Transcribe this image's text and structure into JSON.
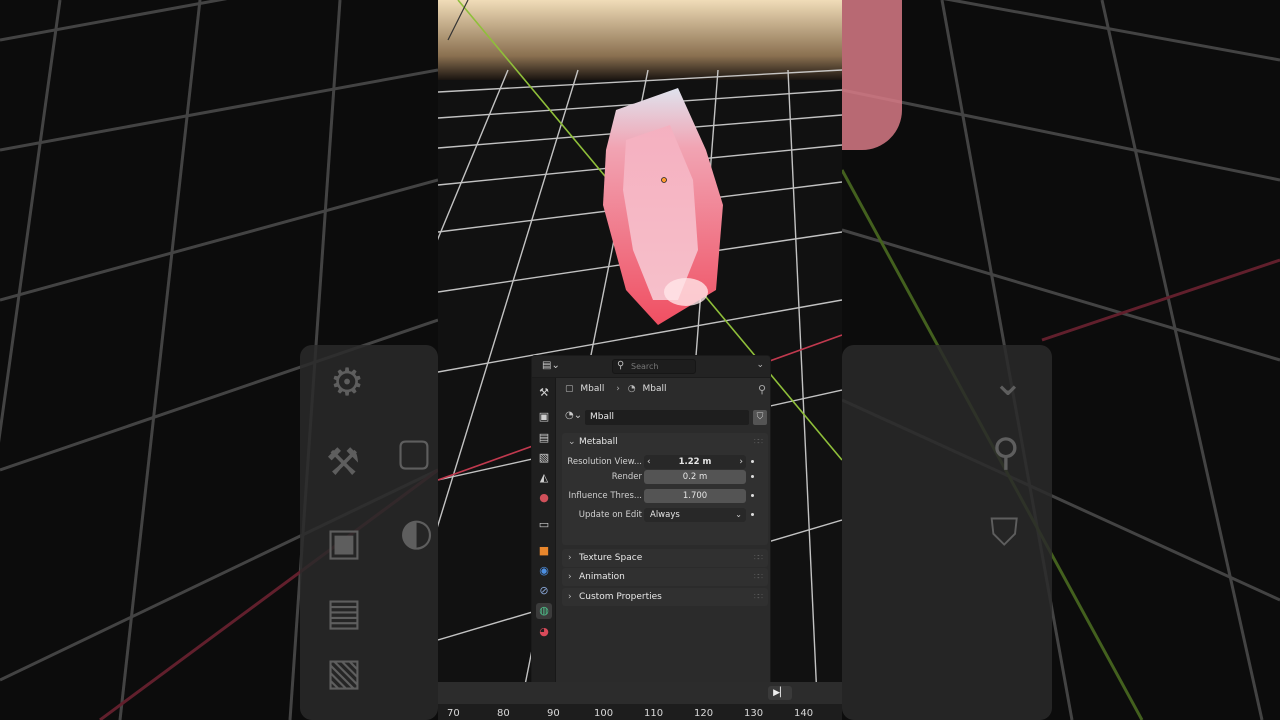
{
  "properties_editor": {
    "search_placeholder": "Search",
    "breadcrumb": {
      "object": "Mball",
      "data": "Mball"
    },
    "datablock_name": "Mball",
    "tabs": [
      {
        "icon": "tool-icon"
      },
      {
        "icon": "render-icon"
      },
      {
        "icon": "output-icon"
      },
      {
        "icon": "view-layer-icon"
      },
      {
        "icon": "scene-icon"
      },
      {
        "icon": "world-icon"
      },
      {
        "icon": "collection-icon"
      },
      {
        "icon": "object-icon"
      },
      {
        "icon": "modifier-icon"
      },
      {
        "icon": "constraint-icon"
      },
      {
        "icon": "metaball-data-icon"
      },
      {
        "icon": "material-icon"
      }
    ],
    "metaball_panel": {
      "title": "Metaball",
      "resolution_viewport_label": "Resolution View...",
      "resolution_viewport_value": "1.22 m",
      "render_label": "Render",
      "render_value": "0.2 m",
      "influence_label": "Influence Thres...",
      "influence_value": "1.700",
      "update_label": "Update on Edit",
      "update_value": "Always"
    },
    "collapsed_panels": [
      "Texture Space",
      "Animation",
      "Custom Properties"
    ]
  },
  "timeline": {
    "frame_numbers": [
      "70",
      "80",
      "90",
      "100",
      "110",
      "120",
      "130",
      "140"
    ]
  },
  "colors": {
    "panel_bg": "#2b2b2b",
    "viewport_bg": "#111111",
    "crystal": "#f07a8a",
    "x_axis": "#c0394e",
    "y_axis": "#8fbf3a"
  }
}
